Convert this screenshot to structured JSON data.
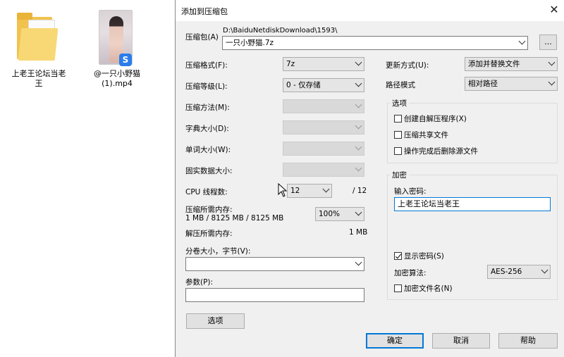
{
  "desktop": {
    "folder_label": "上老王论坛当老王",
    "video_label": "@一只小野猫(1).mp4"
  },
  "dialog": {
    "title": "添加到压缩包",
    "archive_label": "压缩包(A)",
    "archive_path": "D:\\BaiduNetdiskDownload\\1593\\",
    "archive_name": "一只小野猫.7z",
    "browse_label": "...",
    "format_label": "压缩格式(F):",
    "format_value": "7z",
    "level_label": "压缩等级(L):",
    "level_value": "0 - 仅存储",
    "method_label": "压缩方法(M):",
    "dict_label": "字典大小(D):",
    "word_label": "单词大小(W):",
    "solid_label": "固实数据大小:",
    "cpu_label": "CPU 线程数:",
    "cpu_value": "12",
    "cpu_total": "/ 12",
    "mem_compress_label": "压缩所需内存:",
    "mem_compress_value": "1 MB / 8125 MB / 8125 MB",
    "mem_percent": "100%",
    "mem_decompress_label": "解压所需内存:",
    "mem_decompress_value": "1 MB",
    "volume_label": "分卷大小，字节(V):",
    "volume_value": "",
    "params_label": "参数(P):",
    "params_value": "",
    "options_button": "选项",
    "update_label": "更新方式(U):",
    "update_value": "添加并替换文件",
    "pathmode_label": "路径模式",
    "pathmode_value": "相对路径",
    "options_group": "选项",
    "opt_sfx": "创建自解压程序(X)",
    "opt_shared": "压缩共享文件",
    "opt_delete": "操作完成后删除源文件",
    "encrypt_group": "加密",
    "password_label": "输入密码:",
    "password_value": "上老王论坛当老王",
    "show_password": "显示密码(S)",
    "enc_method_label": "加密算法:",
    "enc_method_value": "AES-256",
    "enc_names": "加密文件名(N)",
    "ok": "确定",
    "cancel": "取消",
    "help": "帮助"
  }
}
